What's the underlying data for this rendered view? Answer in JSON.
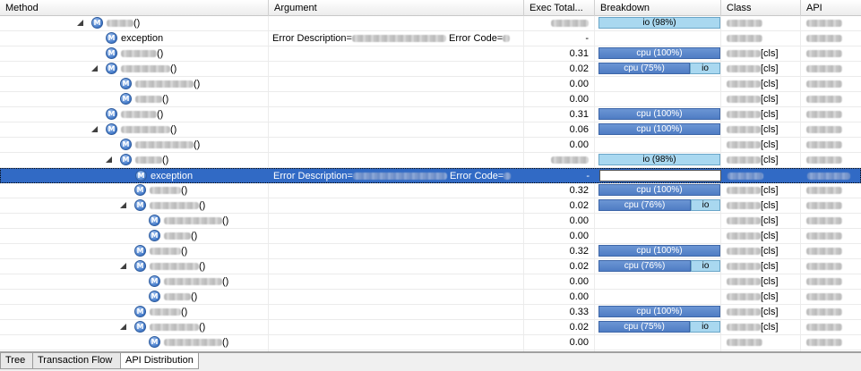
{
  "columns": {
    "method": "Method",
    "argument": "Argument",
    "exec_total": "Exec Total...",
    "breakdown": "Breakdown",
    "class": "Class",
    "api": "API"
  },
  "icon_letter": "M",
  "rows": [
    {
      "level": 0,
      "toggle": true,
      "name": "",
      "blur_w": 30,
      "paren": "()",
      "arg": "",
      "exec": "",
      "exec_blur": true,
      "breakdown": [
        {
          "kind": "io",
          "label": "io (98%)",
          "pct": 0.98
        }
      ],
      "cls": "",
      "cls_suffix": "",
      "api": ""
    },
    {
      "level": 1,
      "toggle": false,
      "name": "exception",
      "paren": "",
      "arg_parts": [
        "Error Description=",
        "",
        "Error Code="
      ],
      "exec": "-",
      "breakdown": [],
      "cls": "",
      "cls_suffix": "",
      "api": ""
    },
    {
      "level": 1,
      "toggle": false,
      "name": "",
      "blur_w": 40,
      "paren": "()",
      "arg": "",
      "exec": "0.31",
      "breakdown": [
        {
          "kind": "cpu",
          "label": "cpu (100%)",
          "pct": 1.0
        }
      ],
      "cls": "",
      "cls_suffix": "[cls]",
      "api": ""
    },
    {
      "level": 1,
      "toggle": true,
      "name": "",
      "blur_w": 55,
      "paren": "()",
      "arg": "",
      "exec": "0.02",
      "breakdown": [
        {
          "kind": "cpu",
          "label": "cpu (75%)",
          "pct": 0.75
        },
        {
          "kind": "io",
          "label": "io",
          "pct": 0.25
        }
      ],
      "cls": "",
      "cls_suffix": "[cls]",
      "api": ""
    },
    {
      "level": 2,
      "toggle": false,
      "name": "",
      "blur_w": 65,
      "paren": "()",
      "arg": "",
      "exec": "0.00",
      "breakdown": [],
      "cls": "",
      "cls_suffix": "[cls]",
      "api": ""
    },
    {
      "level": 2,
      "toggle": false,
      "name": "",
      "blur_w": 30,
      "paren": "()",
      "arg": "",
      "exec": "0.00",
      "breakdown": [],
      "cls": "",
      "cls_suffix": "[cls]",
      "api": ""
    },
    {
      "level": 1,
      "toggle": false,
      "name": "",
      "blur_w": 40,
      "paren": "()",
      "arg": "",
      "exec": "0.31",
      "breakdown": [
        {
          "kind": "cpu",
          "label": "cpu (100%)",
          "pct": 1.0
        }
      ],
      "cls": "",
      "cls_suffix": "[cls]",
      "api": ""
    },
    {
      "level": 1,
      "toggle": true,
      "name": "",
      "blur_w": 55,
      "paren": "()",
      "arg": "",
      "exec": "0.06",
      "breakdown": [
        {
          "kind": "cpu",
          "label": "cpu (100%)",
          "pct": 1.0
        }
      ],
      "cls": "",
      "cls_suffix": "[cls]",
      "api": ""
    },
    {
      "level": 2,
      "toggle": false,
      "name": "",
      "blur_w": 65,
      "paren": "()",
      "arg": "",
      "exec": "0.00",
      "breakdown": [],
      "cls": "",
      "cls_suffix": "[cls]",
      "api": ""
    },
    {
      "level": 2,
      "toggle": true,
      "name": "",
      "blur_w": 30,
      "paren": "()",
      "arg": "",
      "exec": "",
      "exec_blur": true,
      "breakdown": [
        {
          "kind": "io",
          "label": "io (98%)",
          "pct": 0.98
        }
      ],
      "cls": "",
      "cls_suffix": "[cls]",
      "api": ""
    },
    {
      "level": 3,
      "toggle": false,
      "name": "exception",
      "paren": "",
      "arg_parts": [
        "Error Description=",
        "",
        "Error Code="
      ],
      "exec": "-",
      "breakdown": [
        {
          "kind": "empty",
          "label": "",
          "pct": 1.0
        }
      ],
      "cls": "",
      "cls_suffix": "",
      "api": "",
      "selected": true
    },
    {
      "level": 3,
      "toggle": false,
      "name": "",
      "blur_w": 35,
      "paren": "()",
      "arg": "",
      "exec": "0.32",
      "breakdown": [
        {
          "kind": "cpu",
          "label": "cpu (100%)",
          "pct": 1.0
        }
      ],
      "cls": "",
      "cls_suffix": "[cls]",
      "api": ""
    },
    {
      "level": 3,
      "toggle": true,
      "name": "",
      "blur_w": 55,
      "paren": "()",
      "arg": "",
      "exec": "0.02",
      "breakdown": [
        {
          "kind": "cpu",
          "label": "cpu (76%)",
          "pct": 0.76
        },
        {
          "kind": "io",
          "label": "io",
          "pct": 0.24
        }
      ],
      "cls": "",
      "cls_suffix": "[cls]",
      "api": ""
    },
    {
      "level": 4,
      "toggle": false,
      "name": "",
      "blur_w": 65,
      "paren": "()",
      "arg": "",
      "exec": "0.00",
      "breakdown": [],
      "cls": "",
      "cls_suffix": "[cls]",
      "api": ""
    },
    {
      "level": 4,
      "toggle": false,
      "name": "",
      "blur_w": 30,
      "paren": "()",
      "arg": "",
      "exec": "0.00",
      "breakdown": [],
      "cls": "",
      "cls_suffix": "[cls]",
      "api": ""
    },
    {
      "level": 3,
      "toggle": false,
      "name": "",
      "blur_w": 35,
      "paren": "()",
      "arg": "",
      "exec": "0.32",
      "breakdown": [
        {
          "kind": "cpu",
          "label": "cpu (100%)",
          "pct": 1.0
        }
      ],
      "cls": "",
      "cls_suffix": "[cls]",
      "api": ""
    },
    {
      "level": 3,
      "toggle": true,
      "name": "",
      "blur_w": 55,
      "paren": "()",
      "arg": "",
      "exec": "0.02",
      "breakdown": [
        {
          "kind": "cpu",
          "label": "cpu (76%)",
          "pct": 0.76
        },
        {
          "kind": "io",
          "label": "io",
          "pct": 0.24
        }
      ],
      "cls": "",
      "cls_suffix": "[cls]",
      "api": ""
    },
    {
      "level": 4,
      "toggle": false,
      "name": "",
      "blur_w": 65,
      "paren": "()",
      "arg": "",
      "exec": "0.00",
      "breakdown": [],
      "cls": "",
      "cls_suffix": "[cls]",
      "api": ""
    },
    {
      "level": 4,
      "toggle": false,
      "name": "",
      "blur_w": 30,
      "paren": "()",
      "arg": "",
      "exec": "0.00",
      "breakdown": [],
      "cls": "",
      "cls_suffix": "[cls]",
      "api": ""
    },
    {
      "level": 3,
      "toggle": false,
      "name": "",
      "blur_w": 35,
      "paren": "()",
      "arg": "",
      "exec": "0.33",
      "breakdown": [
        {
          "kind": "cpu",
          "label": "cpu (100%)",
          "pct": 1.0
        }
      ],
      "cls": "",
      "cls_suffix": "[cls]",
      "api": ""
    },
    {
      "level": 3,
      "toggle": true,
      "name": "",
      "blur_w": 55,
      "paren": "()",
      "arg": "",
      "exec": "0.02",
      "breakdown": [
        {
          "kind": "cpu",
          "label": "cpu (75%)",
          "pct": 0.75
        },
        {
          "kind": "io",
          "label": "io",
          "pct": 0.25
        }
      ],
      "cls": "",
      "cls_suffix": "[cls]",
      "api": ""
    },
    {
      "level": 4,
      "toggle": false,
      "name": "",
      "blur_w": 65,
      "paren": "()",
      "arg": "",
      "exec": "0.00",
      "breakdown": [],
      "cls": "",
      "cls_suffix": "",
      "api": ""
    }
  ],
  "tabs": [
    {
      "label": "Tree",
      "active": false
    },
    {
      "label": "Transaction Flow",
      "active": false
    },
    {
      "label": "API Distribution",
      "active": true
    }
  ],
  "colors": {
    "selection": "#316ac5",
    "cpu": "#5583c9",
    "io": "#a9d8f0"
  }
}
